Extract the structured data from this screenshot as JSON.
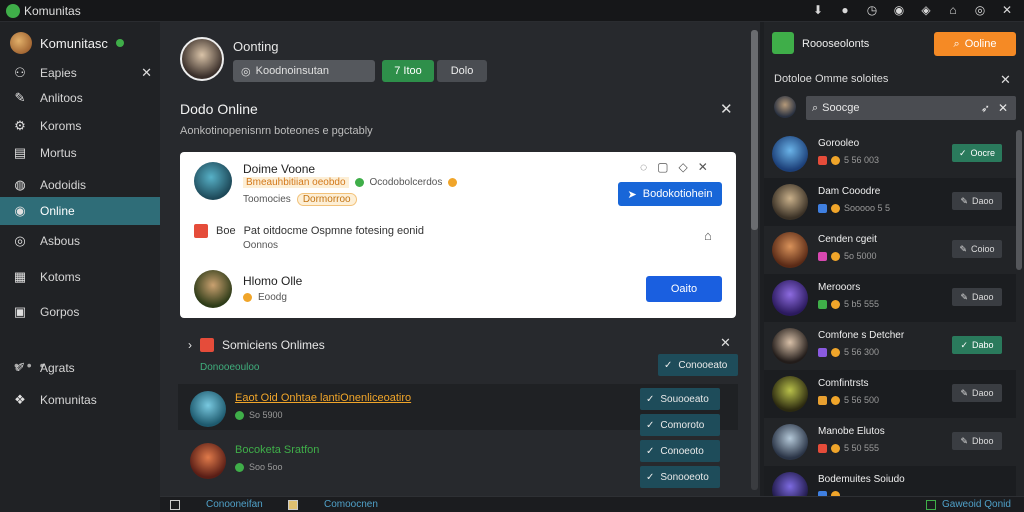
{
  "titlebar": {
    "title": "Komunitas"
  },
  "sidebar": {
    "head": "Komunitasc",
    "items": [
      {
        "label": "Eapies",
        "icon": "people-icon"
      },
      {
        "label": "Anlitoos",
        "icon": "pen-icon"
      },
      {
        "label": "Koroms",
        "icon": "gear-icon"
      },
      {
        "label": "Mortus",
        "icon": "document-icon"
      },
      {
        "label": "Aodoidis",
        "icon": "globe-icon"
      },
      {
        "label": "Online",
        "icon": "online-icon"
      },
      {
        "label": "Asbous",
        "icon": "chat-icon"
      },
      {
        "label": "Kotoms",
        "icon": "grid-icon"
      },
      {
        "label": "Gorpos",
        "icon": "group-icon"
      },
      {
        "label": "Agrats",
        "icon": "brush-icon"
      },
      {
        "label": "Komunitas",
        "icon": "community-icon"
      }
    ]
  },
  "main": {
    "profile_name": "Oonting",
    "profile_input": "Koodnoinsutan",
    "green_button": "Itoo",
    "grey_button": "Dolo",
    "section_title": "Dodo Online",
    "section_sub": "Aonkotinopenisnrn boteones e pgctably",
    "card": {
      "user1_name": "Doime Voone",
      "user1_orange": "Bmeauhbitiian oeobdo",
      "user1_status": "Ocodobolcerdos",
      "user1_role": "Toomocies",
      "user1_tag": "Dormorroo",
      "primary_button": "Bodokotiohein",
      "row_title": "Pat oitdocme Ospmne fotesing eonid",
      "row_prefix": "Boe",
      "row_sub": "Oonnos",
      "user2_name": "Hlomo Olle",
      "user2_sub": "Eoodg",
      "secondary_button": "Oaito"
    },
    "community": {
      "title": "Somiciens Onlimes",
      "sub": "Donooeouloo",
      "header_button": "Conooeato",
      "rows": [
        {
          "name": "Eaot Oid Onhtae lantiOnenliceoatiro",
          "meta": "So 5900",
          "button": "Souooeato"
        },
        {
          "name": "Bocoketa Sratfon",
          "meta": "Soo 5oo",
          "button": "Comoroto"
        },
        {
          "name": "",
          "meta": "",
          "button": "Conoeoto"
        },
        {
          "name": "",
          "meta": "",
          "button": "Sonooeoto"
        }
      ]
    }
  },
  "right": {
    "title": "Roooseolonts",
    "orange_button": "Ooline",
    "section": "Dotoloe Omme soloites",
    "search": "Soocge",
    "rows": [
      {
        "name": "Gorooleo",
        "meta": "5 56 003",
        "button": "Oocre",
        "on": true
      },
      {
        "name": "Dam Cooodre",
        "meta": "Sooooo 5 5",
        "button": "Daoo",
        "on": false
      },
      {
        "name": "Cenden cgeit",
        "meta": "5o 5000",
        "button": "Coioo",
        "on": false
      },
      {
        "name": "Merooors",
        "meta": "5 b5 555",
        "button": "Daoo",
        "on": false
      },
      {
        "name": "Comfone s Detcher",
        "meta": "5 56 300",
        "button": "Dabo",
        "on": true
      },
      {
        "name": "Comfintrsts",
        "meta": "5 56 500",
        "button": "Daoo",
        "on": false
      },
      {
        "name": "Manobe Elutos",
        "meta": "5 50 555",
        "button": "Dboo",
        "on": false
      },
      {
        "name": "Bodemuites Soiudo",
        "meta": "",
        "button": "",
        "on": false
      }
    ]
  },
  "bottom": {
    "item1": "Conooneifan",
    "item2": "Comoocnen",
    "item3": "Gaweoid Qonid"
  }
}
